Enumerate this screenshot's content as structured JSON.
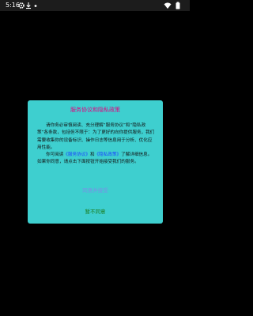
{
  "status_bar": {
    "time": "5:16",
    "icons": [
      "gear-icon",
      "download-icon",
      "dot-icon",
      "wifi-icon",
      "battery-icon"
    ]
  },
  "dialog": {
    "title": "服务协议和隐私政策",
    "paragraph1": "请你务必审慎阅读、充分理解“服务协议”和“隐私政策”各条款，包括但不限于：为了更好的向你提供服务，我们需要收集你的设备标识、操作日志等信息用于分析、优化应用性能。",
    "paragraph2_prefix": "你可阅读",
    "service_link": "《服务协议》",
    "paragraph2_and": "和",
    "privacy_link": "《隐私政策》",
    "paragraph2_suffix": "了解详细信息。如果你同意，请点击下面按钮开始接受我们的服务。",
    "agree_button": "同意并接受",
    "disagree_button": "暂不同意"
  },
  "colors": {
    "background": "#000000",
    "dialog_bg": "#3ecfcf",
    "title": "#e3007f",
    "link": "#1a3fff",
    "agree": "#7d8ce8",
    "disagree": "#1a7a1a"
  }
}
